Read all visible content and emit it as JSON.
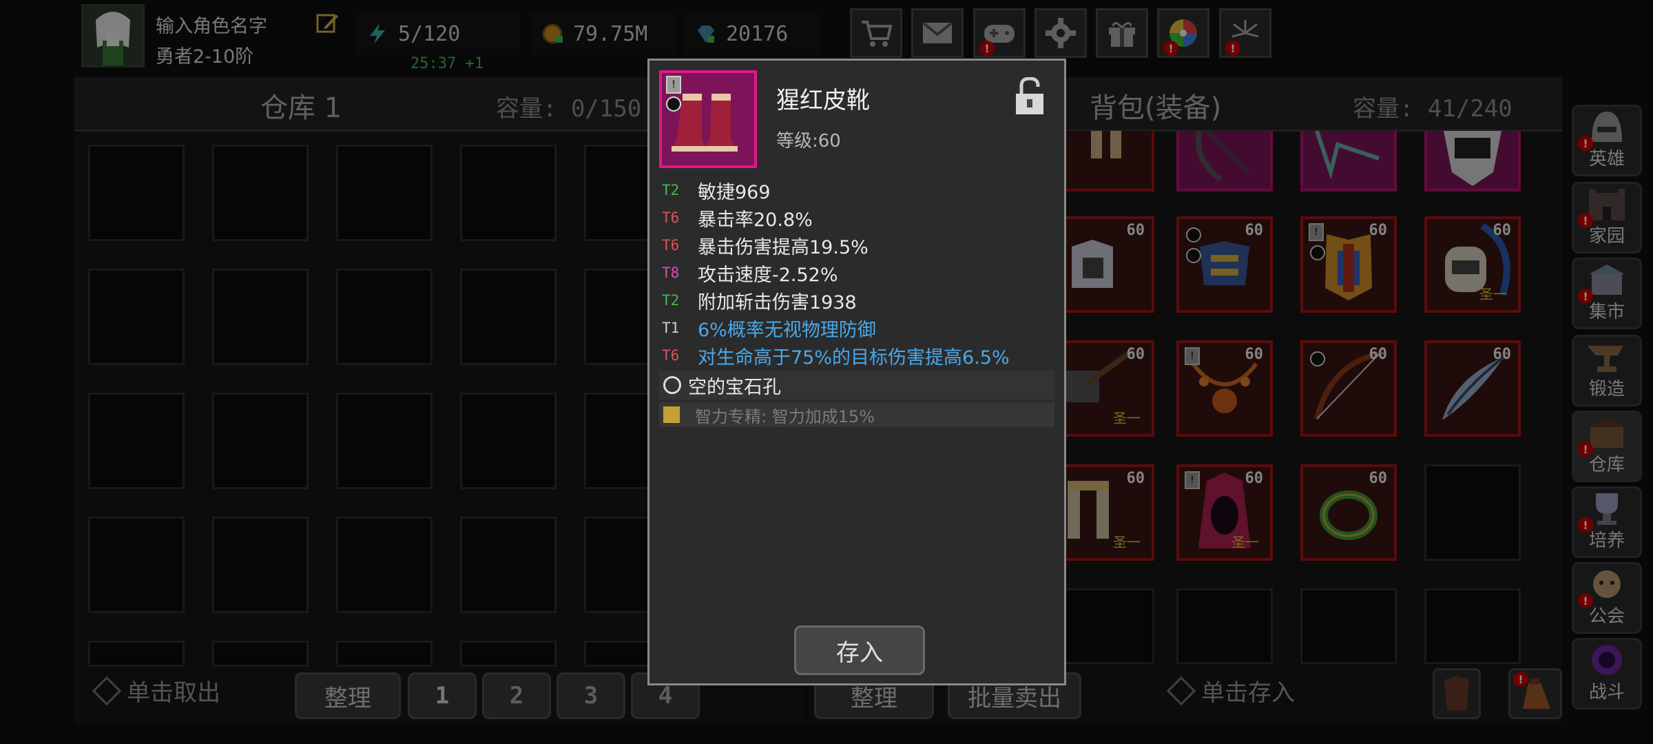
{
  "player": {
    "name": "输入角色名字",
    "rank": "勇者2-10阶"
  },
  "stats": {
    "energy": "5/120",
    "energy_timer": "25:37 +1",
    "gold": "79.75M",
    "gems": "20176"
  },
  "top_buttons": [
    "shop-cart",
    "mail",
    "gamepad",
    "settings",
    "gift",
    "lucky-wheel",
    "fireworks"
  ],
  "warehouse": {
    "title": "仓库 1",
    "capacity": "容量: 0/150"
  },
  "backpack": {
    "title": "背包(装备)",
    "capacity": "容量: 41/240"
  },
  "bottom_left": {
    "hint": "单击取出",
    "sort": "整理",
    "pages": [
      "1",
      "2",
      "3",
      "4"
    ]
  },
  "bottom_right": {
    "sort": "整理",
    "bulk_sell": "批量卖出",
    "hint": "单击存入"
  },
  "sidebar": [
    {
      "label": "英雄",
      "alert": true
    },
    {
      "label": "家园",
      "alert": true
    },
    {
      "label": "集市",
      "alert": true
    },
    {
      "label": "锻造",
      "alert": false
    },
    {
      "label": "仓库",
      "alert": true
    },
    {
      "label": "培养",
      "alert": true
    },
    {
      "label": "公会",
      "alert": true
    },
    {
      "label": "战斗",
      "alert": false
    }
  ],
  "backpack_items": [
    {
      "level": "",
      "holy": ""
    },
    {
      "level": "",
      "holy": ""
    },
    {
      "level": "",
      "holy": ""
    },
    {
      "level": "",
      "holy": ""
    },
    {
      "level": "60",
      "holy": ""
    },
    {
      "level": "60",
      "holy": ""
    },
    {
      "level": "60",
      "holy": ""
    },
    {
      "level": "60",
      "holy": "圣一"
    },
    {
      "level": "60",
      "holy": "圣一"
    },
    {
      "level": "60",
      "holy": ""
    },
    {
      "level": "60",
      "holy": ""
    },
    {
      "level": "60",
      "holy": ""
    },
    {
      "level": "60",
      "holy": "圣一"
    },
    {
      "level": "60",
      "holy": "圣一"
    },
    {
      "level": "60",
      "holy": ""
    }
  ],
  "tooltip": {
    "item_name": "猩红皮靴",
    "level": "等级:60",
    "stats": [
      {
        "tier": "T2",
        "text": "敏捷969",
        "tier_color": "#3cc04c",
        "text_color": "#e8e8e8"
      },
      {
        "tier": "T6",
        "text": "暴击率20.8%",
        "tier_color": "#e0505a",
        "text_color": "#e8e8e8"
      },
      {
        "tier": "T6",
        "text": "暴击伤害提高19.5%",
        "tier_color": "#e0505a",
        "text_color": "#e8e8e8"
      },
      {
        "tier": "T8",
        "text": "攻击速度-2.52%",
        "tier_color": "#e04ab0",
        "text_color": "#e8e8e8"
      },
      {
        "tier": "T2",
        "text": "附加斩击伤害1938",
        "tier_color": "#3cc04c",
        "text_color": "#e8e8e8"
      },
      {
        "tier": "T1",
        "text": "6%概率无视物理防御",
        "tier_color": "#d0d0d0",
        "text_color": "#4aa8e8"
      },
      {
        "tier": "T6",
        "text": "对生命高于75%的目标伤害提高6.5%",
        "tier_color": "#e0505a",
        "text_color": "#4aa8e8"
      }
    ],
    "socket_text": "空的宝石孔",
    "passive_text": "智力专精: 智力加成15%",
    "store_button": "存入"
  }
}
